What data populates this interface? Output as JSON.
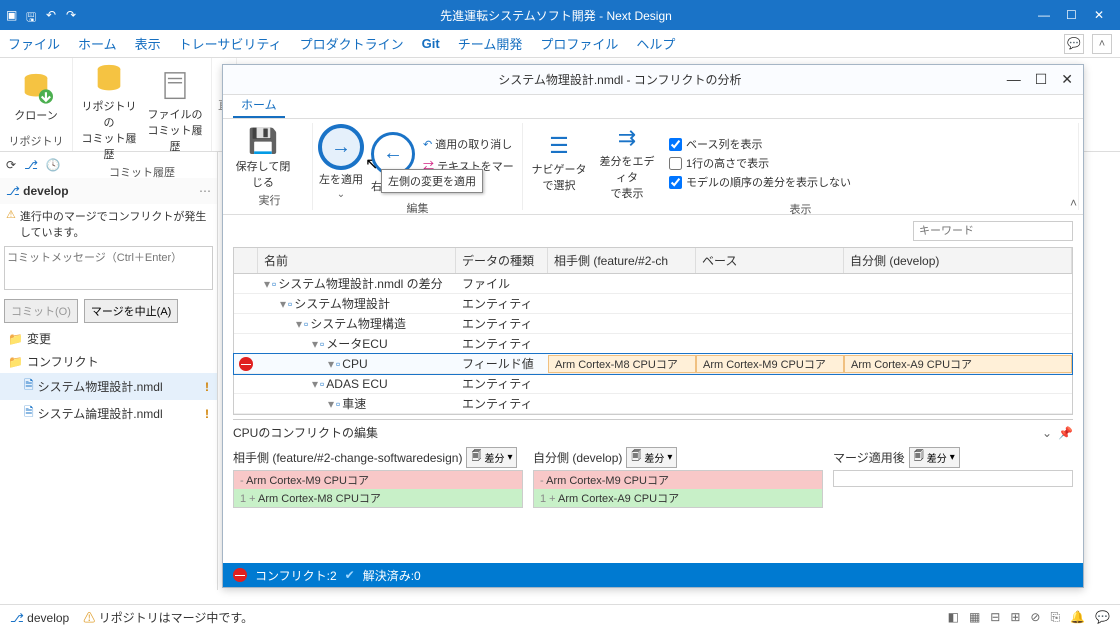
{
  "titlebar": {
    "title": "先進運転システムソフト開発 - Next Design"
  },
  "menu": {
    "items": [
      "ファイル",
      "ホーム",
      "表示",
      "トレーサビリティ",
      "プロダクトライン",
      "Git",
      "チーム開発",
      "プロファイル",
      "ヘルプ"
    ],
    "active": "Git"
  },
  "ribbon": {
    "clone": "クローン",
    "repo_history": "リポジトリの\nコミット履歴",
    "file_history": "ファイルの\nコミット履歴",
    "group_repo": "リポジトリ",
    "group_history": "コミット履歴"
  },
  "left": {
    "branch": "develop",
    "warning": "進行中のマージでコンフリクトが発生しています。",
    "commit_placeholder": "コミットメッセージ（Ctrl＋Enter）",
    "commit_btn": "コミット(O)",
    "abort_btn": "マージを中止(A)",
    "tree": {
      "changes": "変更",
      "conflicts": "コンフリクト",
      "file1": "システム物理設計.nmdl",
      "file2": "システム論理設計.nmdl"
    }
  },
  "inner": {
    "title": "システム物理設計.nmdl - コンフリクトの分析",
    "tab_home": "ホーム",
    "save_close": "保存して閉じる",
    "apply_left": "左を適用",
    "apply_right": "右を適用",
    "tooltip": "左側の変更を適用",
    "undo_apply": "適用の取り消し",
    "merge_text": "テキストをマージ",
    "nav_select": "ナビゲータで選択",
    "editor_show": "差分をエディタ\nで表示",
    "chk_base": "ベース列を表示",
    "chk_1row": "1行の高さで表示",
    "chk_order": "モデルの順序の差分を表示しない",
    "group_exec": "実行",
    "group_edit": "編集",
    "group_view": "表示",
    "search_placeholder": "キーワード",
    "table": {
      "hdr_name": "名前",
      "hdr_type": "データの種類",
      "hdr_other": "相手側 (feature/#2-ch",
      "hdr_base": "ベース",
      "hdr_self": "自分側 (develop)",
      "rows": [
        {
          "name": "システム物理設計.nmdl の差分",
          "type": "ファイル",
          "indent": 0
        },
        {
          "name": "システム物理設計",
          "type": "エンティティ",
          "indent": 1
        },
        {
          "name": "システム物理構造",
          "type": "エンティティ",
          "indent": 2
        },
        {
          "name": "メータECU",
          "type": "エンティティ",
          "indent": 3
        },
        {
          "name": "CPU",
          "type": "フィールド値",
          "indent": 4,
          "conflict": true,
          "other": "Arm Cortex-M8 CPUコア",
          "base": "Arm Cortex-M9 CPUコア",
          "self": "Arm Cortex-A9 CPUコア",
          "sel": true
        },
        {
          "name": "ADAS ECU",
          "type": "エンティティ",
          "indent": 3
        },
        {
          "name": "車速",
          "type": "エンティティ",
          "indent": 4
        }
      ]
    },
    "edit_title": "CPUのコンフリクトの編集",
    "left_title": "相手側 (feature/#2-change-softwaredesign)",
    "mid_title": "自分側 (develop)",
    "right_title": "マージ適用後",
    "diff_btn": "差分",
    "left_del": "Arm Cortex-M9 CPUコア",
    "left_add": "Arm Cortex-M8 CPUコア",
    "mid_del": "Arm Cortex-M9 CPUコア",
    "mid_add": "Arm Cortex-A9 CPUコア",
    "status_conflict": "コンフリクト:2",
    "status_resolved": "解決済み:0"
  },
  "status": {
    "branch": "develop",
    "merging": "リポジトリはマージ中です。"
  }
}
